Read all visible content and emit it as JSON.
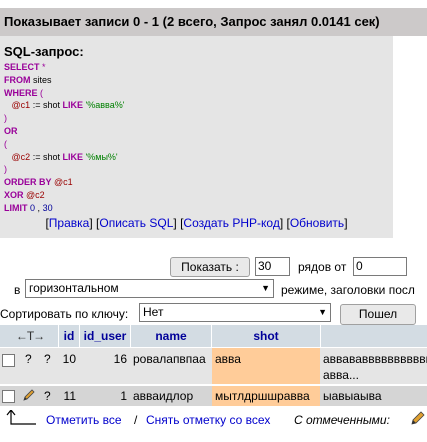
{
  "result_message": "Показывает записи 0 - 1 (2 всего, Запрос занял 0.0141 сек)",
  "sql": {
    "title": "SQL-запрос:",
    "select": "SELECT",
    "star": "*",
    "from": "FROM",
    "table": "sites",
    "where": "WHERE",
    "lparen": "(",
    "rparen": ")",
    "var1": "@c1",
    "assign": ":=",
    "shot": "shot",
    "like": "LIKE",
    "pattern1": "'%авва%'",
    "or": "OR",
    "var2": "@c2",
    "pattern2": "'%мы%'",
    "order_by": "ORDER BY",
    "xor": "XOR",
    "limit": "LIMIT",
    "limit_from": "0",
    "comma": ",",
    "limit_count": "30"
  },
  "links": {
    "edit": "Правка",
    "explain": "Описать SQL",
    "create_php": "Создать PHP-код",
    "refresh": "Обновить"
  },
  "controls": {
    "show_button": "Показать :",
    "rows_value": "30",
    "rows_from_label": "рядов от",
    "from_value": "0",
    "in_label": "в",
    "mode_value": "горизонтальном",
    "mode_suffix": "режиме, заголовки посл",
    "sort_label": "Сортировать по ключу:",
    "sort_value": "Нет",
    "go_button": "Пошел"
  },
  "table": {
    "nav_arrows": "←T→",
    "columns": [
      "id",
      "id_user",
      "name",
      "shot"
    ],
    "rows": [
      {
        "edit": "?",
        "delete": "?",
        "id": "10",
        "id_user": "16",
        "name": "ровалапвпаа",
        "shot": "авва",
        "extra1": "аввававвввввввввв",
        "extra2": "авва..."
      },
      {
        "edit": "",
        "delete": "?",
        "id": "11",
        "id_user": "1",
        "name": "авваидлор",
        "shot": "мытлдршшравва",
        "extra1": "ыавыаыва",
        "extra2": ""
      }
    ]
  },
  "footer": {
    "check_all": "Отметить все",
    "separator": "/",
    "uncheck_all": "Снять отметку со всех",
    "with_selected": "С отмеченными:"
  },
  "colors": {
    "header_bg": "#d3dce3",
    "row_odd": "#e5e5e5",
    "row_even": "#d5d5d5",
    "link": "#0000cc"
  }
}
